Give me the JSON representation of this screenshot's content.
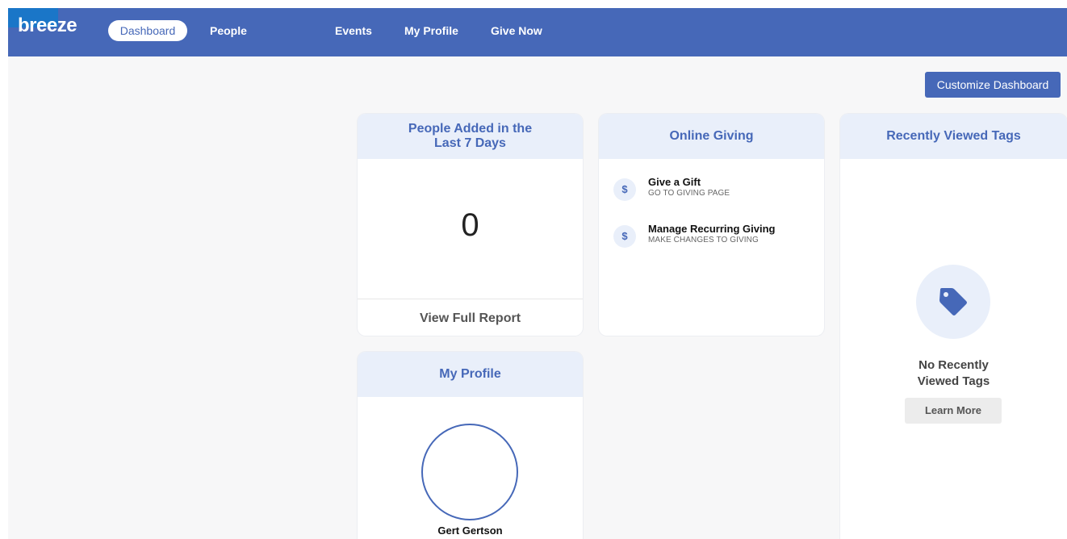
{
  "app": {
    "logo": "breeze"
  },
  "nav": {
    "dashboard": "Dashboard",
    "people": "People",
    "hidden_item": "",
    "events": "Events",
    "my_profile": "My Profile",
    "give_now": "Give Now"
  },
  "toolbar": {
    "customize_label": "Customize Dashboard"
  },
  "people_card": {
    "title_line1": "People Added in the",
    "title_line2": "Last 7 Days",
    "count": "0",
    "report_label": "View Full Report"
  },
  "giving_card": {
    "title": "Online Giving",
    "items": [
      {
        "icon": "$",
        "title": "Give a Gift",
        "subtitle": "GO TO GIVING PAGE"
      },
      {
        "icon": "$",
        "title": "Manage Recurring Giving",
        "subtitle": "MAKE CHANGES TO GIVING"
      }
    ]
  },
  "tags_card": {
    "title": "Recently Viewed Tags",
    "empty_line1": "No Recently",
    "empty_line2": "Viewed Tags",
    "learn_more": "Learn More",
    "icon": "tag-icon"
  },
  "profile_card": {
    "title": "My Profile",
    "name": "Gert Gertson"
  },
  "colors": {
    "brand": "#4668b8",
    "header_tint": "#e9effa",
    "redacted_block": "#1a76c8"
  }
}
